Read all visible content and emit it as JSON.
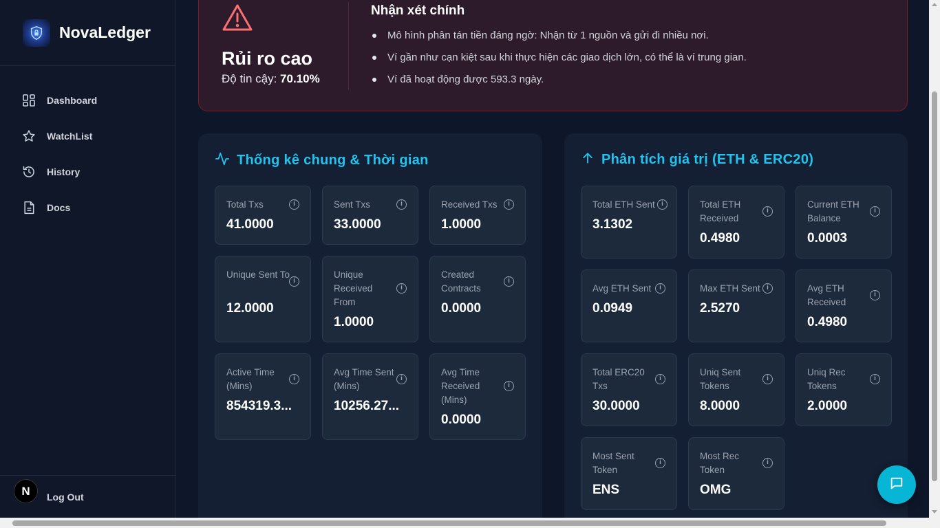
{
  "app": {
    "name": "NovaLedger"
  },
  "sidebar": {
    "items": [
      {
        "label": "Dashboard",
        "icon": "dashboard-icon"
      },
      {
        "label": "WatchList",
        "icon": "star-icon"
      },
      {
        "label": "History",
        "icon": "history-icon"
      },
      {
        "label": "Docs",
        "icon": "document-icon"
      }
    ],
    "logout_label": "Log Out",
    "next_badge": "N"
  },
  "risk": {
    "title": "Rủi ro cao",
    "confidence_label": "Độ tin cậy:",
    "confidence_value": "70.10%",
    "insights_title": "Nhận xét chính",
    "insights": [
      "Mô hình phân tán tiền đáng ngờ: Nhận từ 1 nguồn và gửi đi nhiều nơi.",
      "Ví gần như cạn kiệt sau khi thực hiện các giao dịch lớn, có thể là ví trung gian.",
      "Ví đã hoạt động được 593.3 ngày."
    ]
  },
  "general_stats": {
    "title": "Thống kê chung & Thời gian",
    "items": [
      {
        "label": "Total Txs",
        "value": "41.0000"
      },
      {
        "label": "Sent Txs",
        "value": "33.0000"
      },
      {
        "label": "Received Txs",
        "value": "1.0000"
      },
      {
        "label": "Unique Sent To",
        "value": "12.0000"
      },
      {
        "label": "Unique Received From",
        "value": "1.0000"
      },
      {
        "label": "Created Contracts",
        "value": "0.0000"
      },
      {
        "label": "Active Time (Mins)",
        "value": "854319.3..."
      },
      {
        "label": "Avg Time Sent (Mins)",
        "value": "10256.27..."
      },
      {
        "label": "Avg Time Received (Mins)",
        "value": "0.0000"
      }
    ]
  },
  "value_stats": {
    "title": "Phân tích giá trị (ETH & ERC20)",
    "items": [
      {
        "label": "Total ETH Sent",
        "value": "3.1302"
      },
      {
        "label": "Total ETH Received",
        "value": "0.4980"
      },
      {
        "label": "Current ETH Balance",
        "value": "0.0003"
      },
      {
        "label": "Avg ETH Sent",
        "value": "0.0949"
      },
      {
        "label": "Max ETH Sent",
        "value": "2.5270"
      },
      {
        "label": "Avg ETH Received",
        "value": "0.4980"
      },
      {
        "label": "Total ERC20 Txs",
        "value": "30.0000"
      },
      {
        "label": "Uniq Sent Tokens",
        "value": "8.0000"
      },
      {
        "label": "Uniq Rec Tokens",
        "value": "2.0000"
      },
      {
        "label": "Most Sent Token",
        "value": "ENS"
      },
      {
        "label": "Most Rec Token",
        "value": "OMG"
      }
    ]
  },
  "colors": {
    "accent": "#22c3ee",
    "danger": "#f87171",
    "bg": "#0e1729",
    "card": "#1d2a3c"
  }
}
